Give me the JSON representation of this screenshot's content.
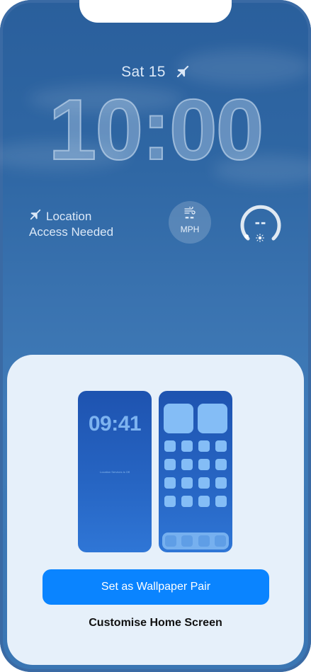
{
  "lock_screen": {
    "date": "Sat 15",
    "time": "10:00",
    "location_line1": "Location",
    "location_line2": "Access Needed",
    "wind": {
      "value": "--",
      "unit": "MPH"
    },
    "gauge": {
      "value": "--"
    }
  },
  "sheet": {
    "preview_lock_time": "09:41",
    "preview_lock_location": "Location Services is Off",
    "primary_button": "Set as Wallpaper Pair",
    "secondary_button": "Customise Home Screen"
  },
  "colors": {
    "accent": "#0a84ff",
    "sheet_bg": "#e6f0fa",
    "wallpaper": "#3a73b0"
  }
}
